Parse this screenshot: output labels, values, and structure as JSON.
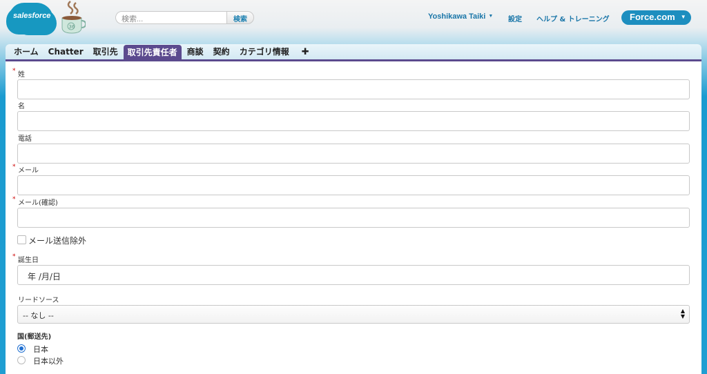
{
  "header": {
    "logo": "salesforce",
    "search_placeholder": "検索...",
    "search_button": "検索",
    "user_name": "Yoshikawa Taiki",
    "setup": "設定",
    "help": "ヘルプ & トレーニング",
    "app_menu": "Force.com",
    "mascot_badge": "36"
  },
  "tabs": [
    {
      "label": "ホーム",
      "active": false
    },
    {
      "label": "Chatter",
      "active": false
    },
    {
      "label": "取引先",
      "active": false
    },
    {
      "label": "取引先責任者",
      "active": true
    },
    {
      "label": "商談",
      "active": false
    },
    {
      "label": "契約",
      "active": false
    },
    {
      "label": "カテゴリ情報",
      "active": false
    },
    {
      "label": "✚",
      "active": false
    }
  ],
  "form": {
    "last_name": {
      "label": "姓",
      "required": true,
      "value": ""
    },
    "first_name": {
      "label": "名",
      "required": false,
      "value": ""
    },
    "phone": {
      "label": "電話",
      "required": false,
      "value": ""
    },
    "email": {
      "label": "メール",
      "required": true,
      "value": ""
    },
    "email_confirm": {
      "label": "メール(確認)",
      "required": true,
      "value": ""
    },
    "email_opt_out": {
      "label": "メール送信除外",
      "checked": false
    },
    "birthdate": {
      "label": "誕生日",
      "required": true,
      "placeholder": "年 /月/日"
    },
    "lead_source": {
      "label": "リードソース",
      "selected": "-- なし --"
    },
    "country": {
      "label": "国(郵送先)",
      "options": [
        {
          "label": "日本",
          "selected": true
        },
        {
          "label": "日本以外",
          "selected": false
        }
      ]
    }
  },
  "colors": {
    "accent": "#5b4a8e",
    "link": "#1a76a8",
    "required": "#cc0000",
    "background_blue": "#1f9ed2"
  }
}
